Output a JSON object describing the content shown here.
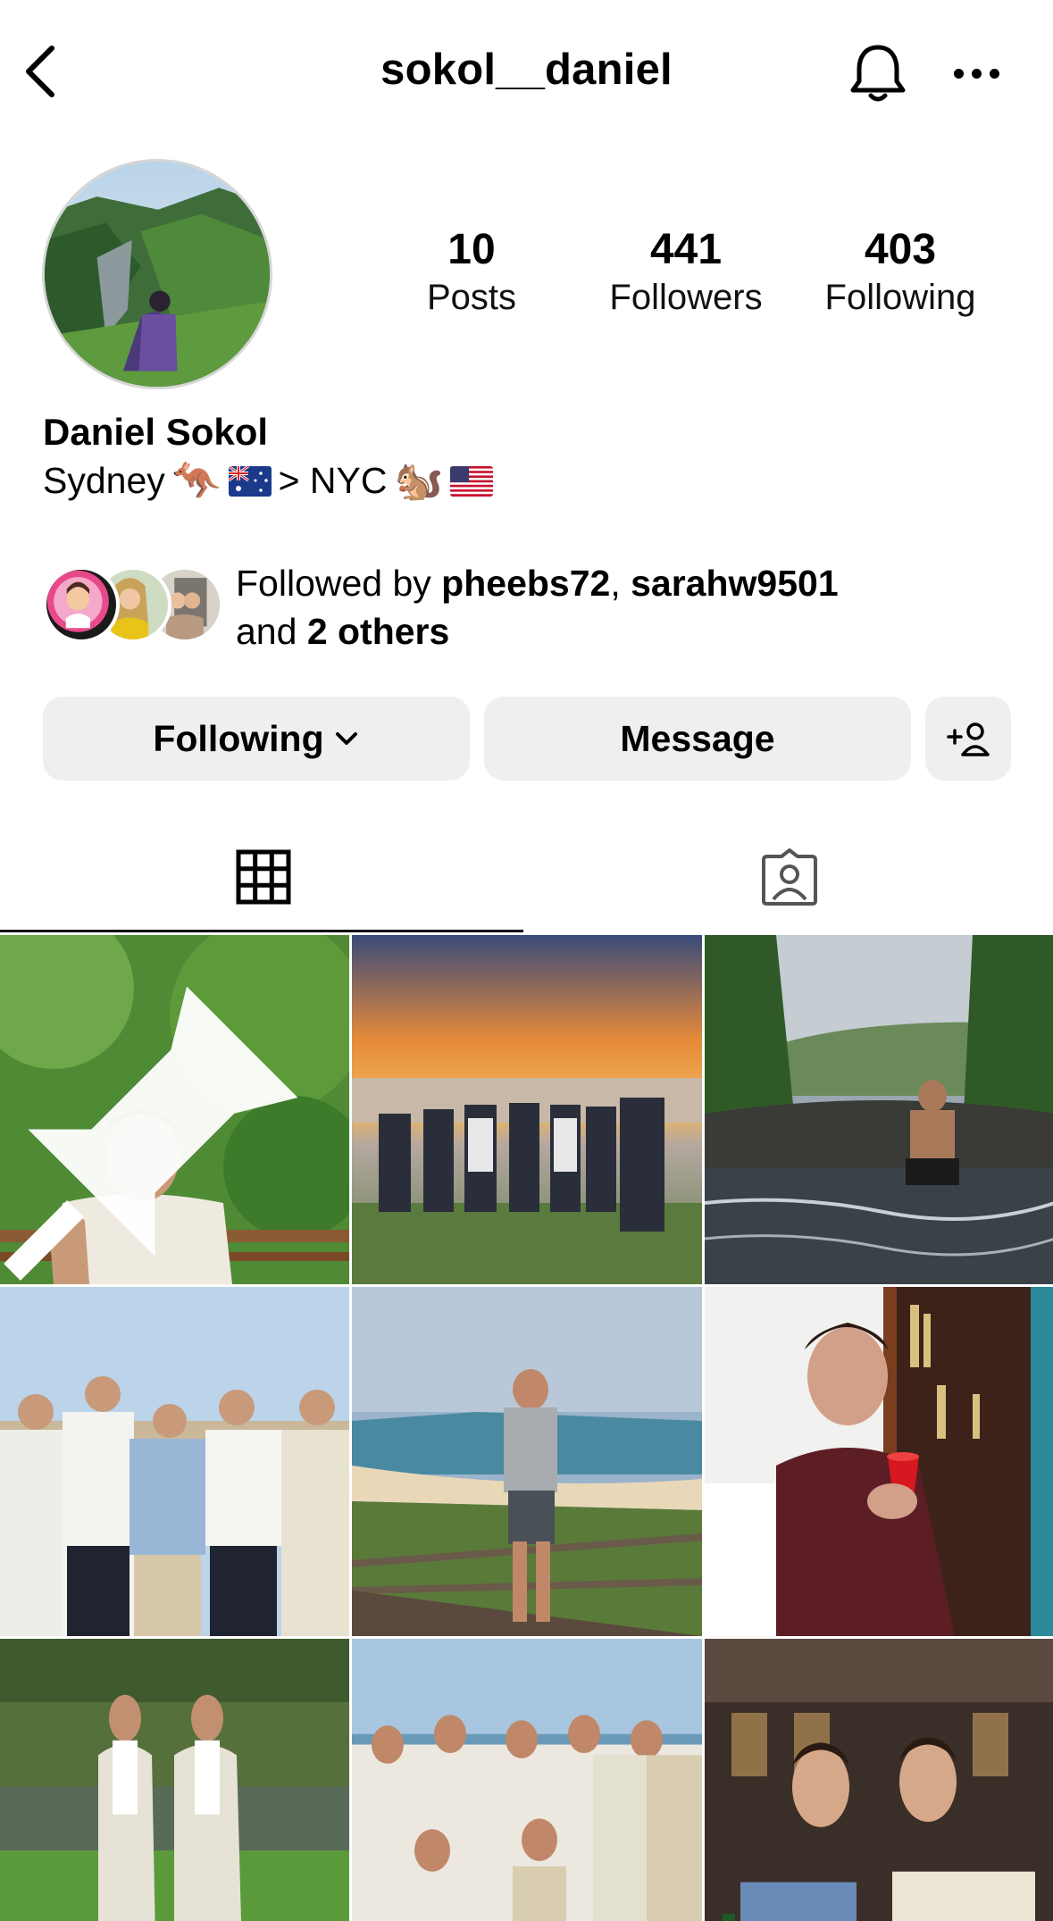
{
  "header": {
    "username": "sokol__daniel",
    "back_icon": "chevron-left-icon",
    "bell_icon": "bell-icon",
    "more_icon": "more-horizontal-icon"
  },
  "profile": {
    "full_name": "Daniel Sokol",
    "bio_parts": {
      "city1": "Sydney",
      "emoji1": "🦘",
      "arrow": "> NYC",
      "emoji2": "🐿️"
    },
    "stats": {
      "posts": {
        "value": "10",
        "label": "Posts"
      },
      "followers": {
        "value": "441",
        "label": "Followers"
      },
      "following": {
        "value": "403",
        "label": "Following"
      }
    }
  },
  "followed_by": {
    "prefix": "Followed by ",
    "user1": "pheebs72",
    "sep": ", ",
    "user2": "sarahw9501",
    "and": "and ",
    "others": "2 others"
  },
  "actions": {
    "following_label": "Following",
    "message_label": "Message"
  },
  "tabs": [
    {
      "name": "posts-grid",
      "icon": "grid-icon",
      "active": true
    },
    {
      "name": "tagged",
      "icon": "tagged-person-icon",
      "active": false
    }
  ],
  "colors": {
    "button_bg": "#efefef",
    "text": "#000000"
  }
}
